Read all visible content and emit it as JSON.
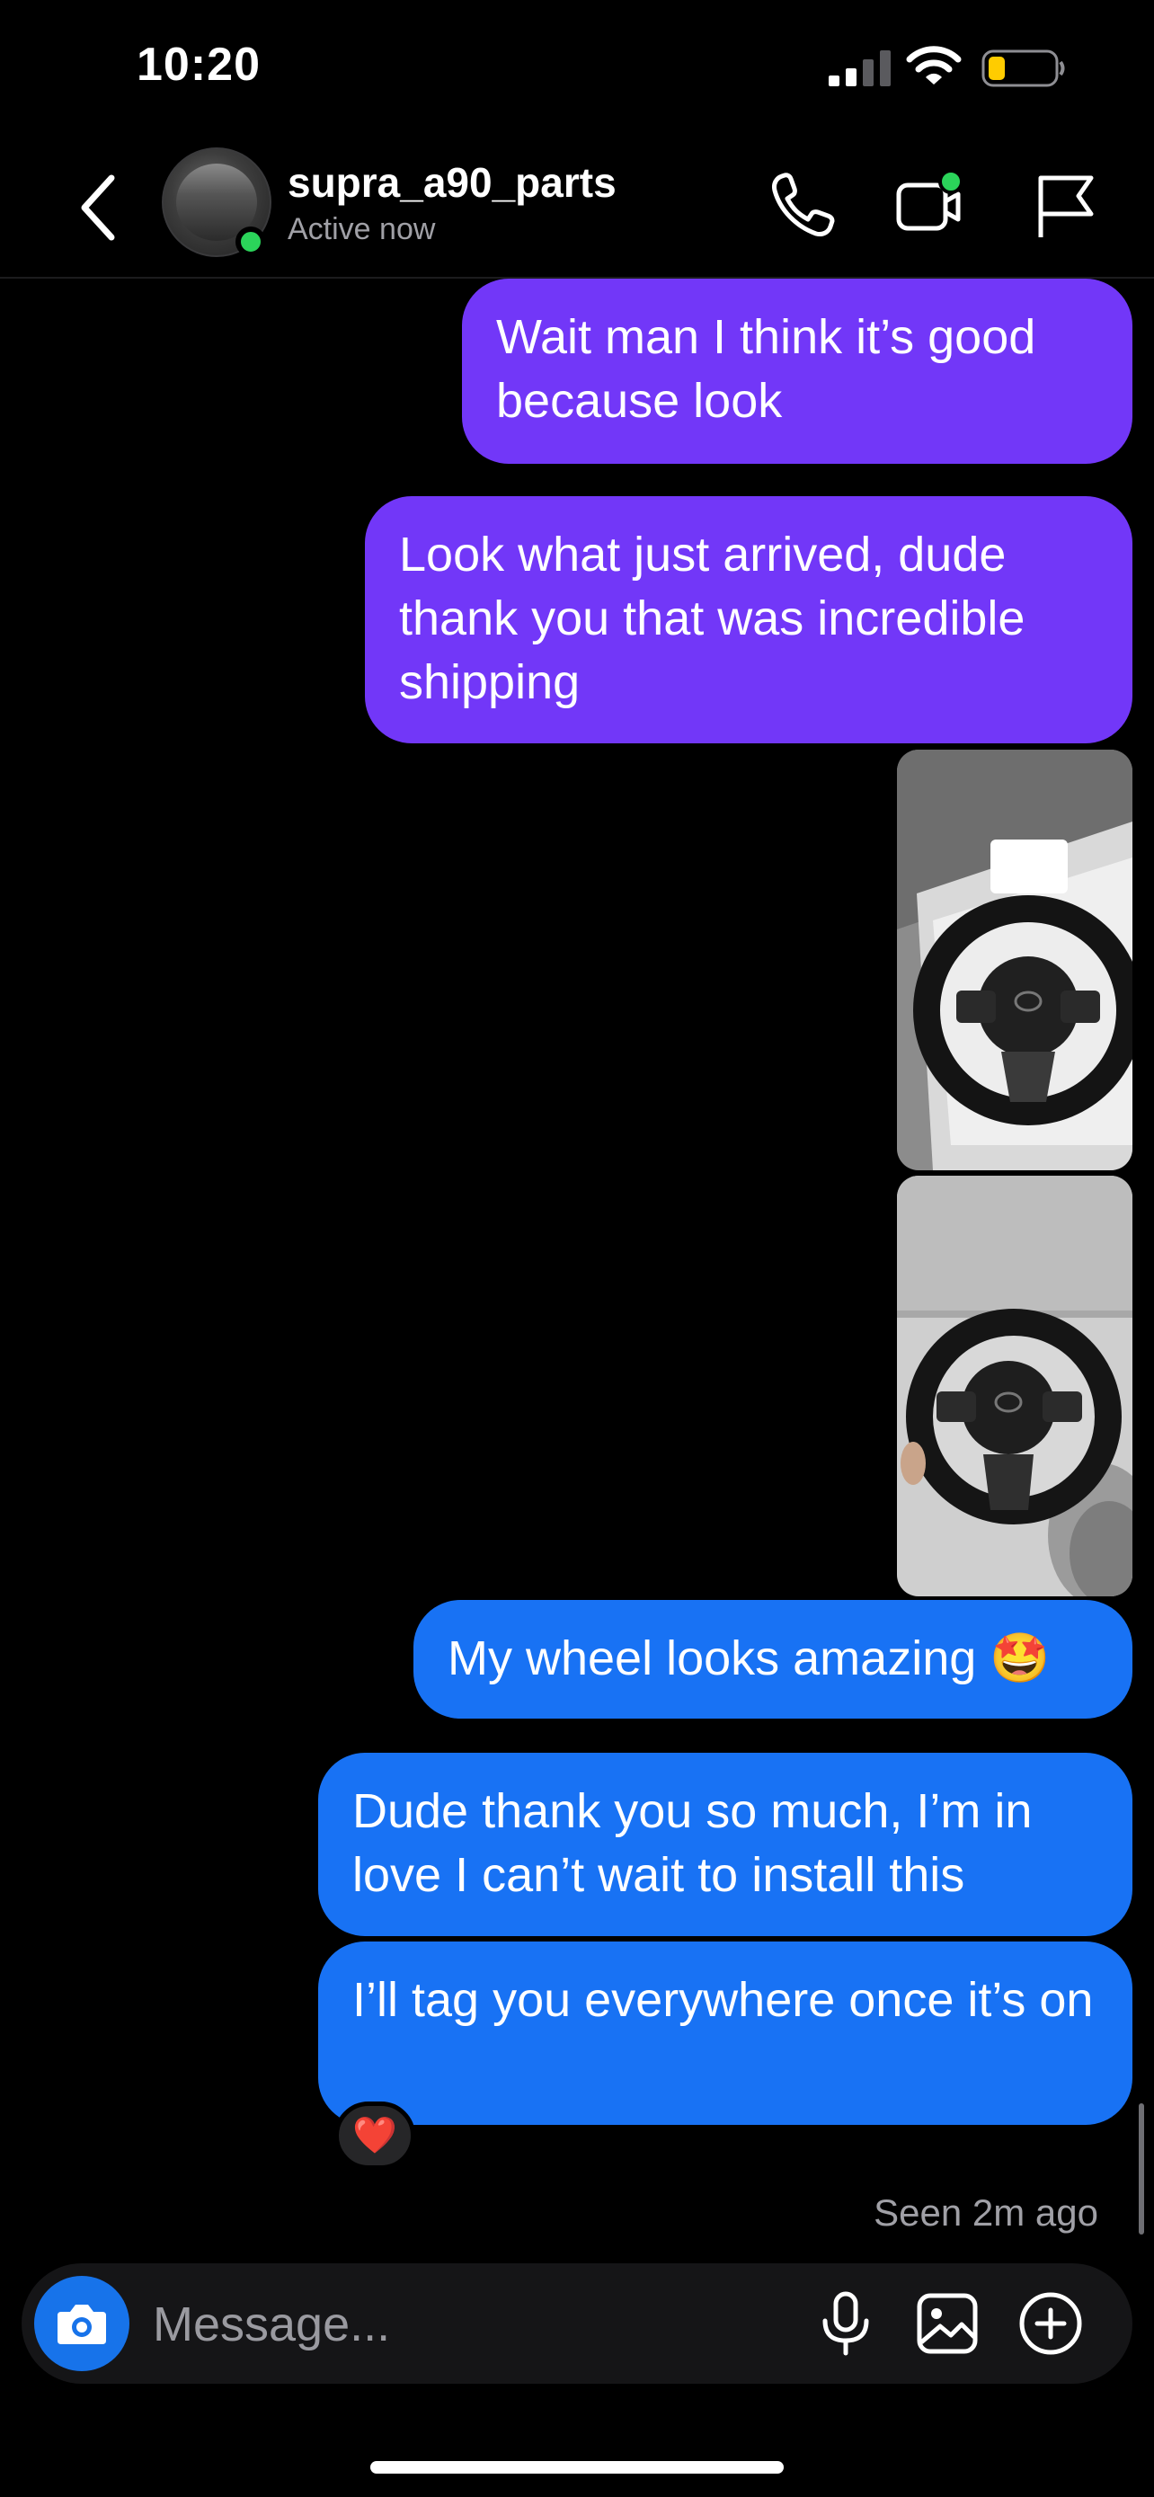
{
  "status_bar": {
    "time": "10:20"
  },
  "header": {
    "username": "supra_a90_parts",
    "presence": "Active now",
    "icons": [
      "chevron-left-icon",
      "phone-icon",
      "video-camera-icon",
      "flag-icon"
    ]
  },
  "messages": [
    {
      "type": "text",
      "color": "#7237f8",
      "text": "Wait man I think it’s good because look"
    },
    {
      "type": "text",
      "color": "#7237f8",
      "text": "Look what just arrived, dude thank you that was incredible shipping"
    },
    {
      "type": "image",
      "depicts": "steering-wheel-in-box"
    },
    {
      "type": "image",
      "depicts": "steering-wheel-on-couch"
    },
    {
      "type": "text",
      "color": "#1872f4",
      "text": "My wheel looks amazing 🤩"
    },
    {
      "type": "text",
      "color": "#1872f4",
      "text": "Dude thank you so much, I’m in love I can’t wait to install this"
    },
    {
      "type": "text",
      "color": "#1872f4",
      "text": "I’ll tag you everywhere once it’s on"
    }
  ],
  "reaction": "❤️",
  "seen": "Seen 2m ago",
  "composer": {
    "placeholder": "Message...",
    "icons": [
      "camera-icon",
      "microphone-icon",
      "gallery-icon",
      "add-icon"
    ]
  },
  "colors": {
    "background": "#000000",
    "purple_bubble": "#7237f8",
    "blue_bubble": "#1872f4",
    "online": "#2bd45a",
    "battery_low": "#ffcc00"
  }
}
